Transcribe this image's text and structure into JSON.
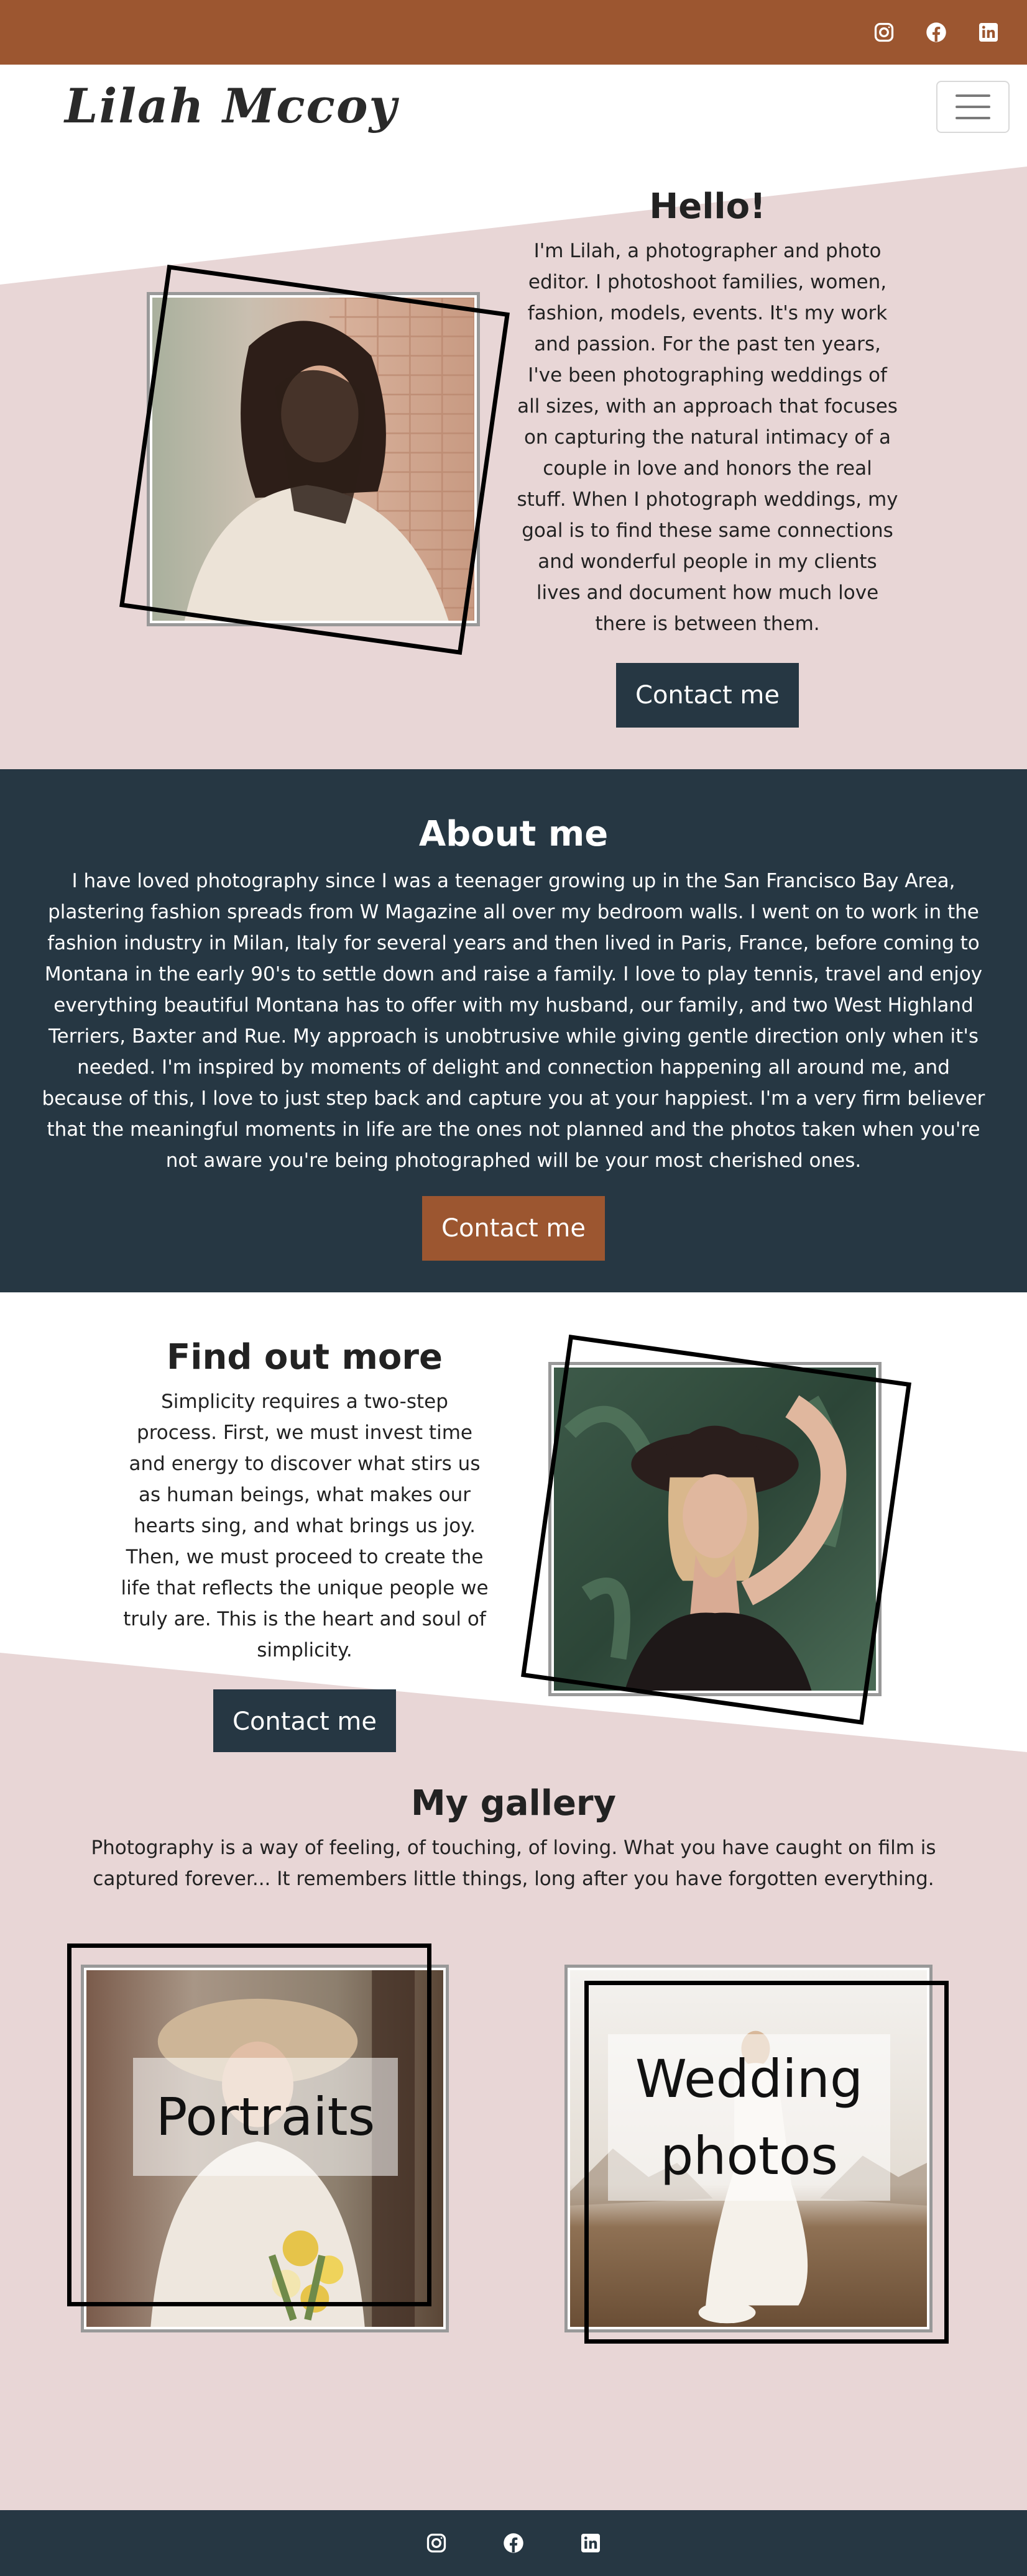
{
  "header": {
    "social": [
      {
        "icon": "instagram-icon"
      },
      {
        "icon": "facebook-icon"
      },
      {
        "icon": "linkedin-icon"
      }
    ]
  },
  "navbar": {
    "brand": "Lilah Mccoy",
    "toggle_icon": "hamburger-menu-icon"
  },
  "hello": {
    "title": "Hello!",
    "text": "I'm Lilah, a photographer and photo editor. I photoshoot families, women, fashion, models, events. It's my work and passion. For the past ten years, I've been photographing weddings of all sizes, with an approach that focuses on capturing the natural intimacy of a couple in love and honors the real stuff. When I photograph weddings, my goal is to find these same connections and wonderful people in my clients lives and document how much love there is between them.",
    "button": "Contact me"
  },
  "about": {
    "title": "About me",
    "text": "I have loved photography since I was a teenager growing up in the San Francisco Bay Area, plastering fashion spreads from W Magazine all over my bedroom walls. I went on to work in the fashion industry in Milan, Italy for several years and then lived in Paris, France, before coming to Montana in the early 90's to settle down and raise a family. I love to play tennis, travel and enjoy everything beautiful Montana has to offer with my husband, our family, and two West Highland Terriers, Baxter and Rue. My approach is unobtrusive while giving gentle direction only when it's needed. I'm inspired by moments of delight and connection happening all around me, and because of this, I love to just step back and capture you at your happiest. I'm a very firm believer that the meaningful moments in life are the ones not planned and the photos taken when you're not aware you're being photographed will be your most cherished ones.",
    "button": "Contact me"
  },
  "findout": {
    "title": "Find out more",
    "text": "Simplicity requires a two-step process. First, we must invest time and energy to discover what stirs us as human beings, what makes our hearts sing, and what brings us joy. Then, we must proceed to create the life that reflects the unique people we truly are. This is the heart and soul of simplicity.",
    "button": "Contact me"
  },
  "gallery": {
    "title": "My gallery",
    "text": "Photography is a way of feeling, of touching, of loving. What you have caught on film is captured forever... It remembers little things, long after you have forgotten everything.",
    "items": [
      {
        "label": "Portraits"
      },
      {
        "label": "Wedding photos"
      }
    ]
  },
  "footer": {
    "social": [
      {
        "icon": "instagram-icon"
      },
      {
        "icon": "facebook-icon"
      },
      {
        "icon": "linkedin-icon"
      }
    ]
  },
  "colors": {
    "brown": "#9c5630",
    "dark_navy": "#263743",
    "pink_background": "#e8d6d6"
  }
}
